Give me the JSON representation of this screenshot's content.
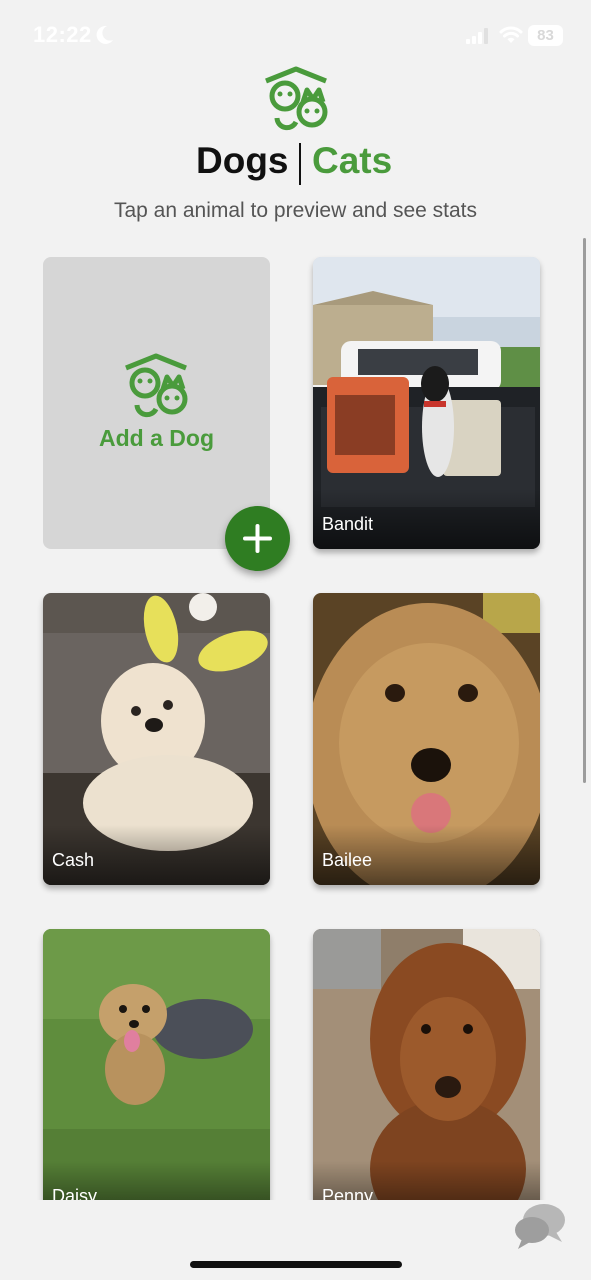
{
  "status_bar": {
    "time": "12:22",
    "battery": "83",
    "icons": [
      "moon-icon",
      "cellular-signal-icon",
      "wifi-icon",
      "battery-icon"
    ]
  },
  "header": {
    "logo_icon": "dog-cat-house-logo-icon",
    "tab_dogs": "Dogs",
    "tab_cats": "Cats",
    "subtitle": "Tap an animal to preview and see stats"
  },
  "add_card": {
    "label": "Add a Dog",
    "button_icon": "plus-icon"
  },
  "animals": [
    {
      "name": "Bandit"
    },
    {
      "name": "Cash"
    },
    {
      "name": "Bailee"
    },
    {
      "name": "Daisy"
    },
    {
      "name": "Penny"
    }
  ],
  "chat_icon": "chat-bubbles-icon",
  "colors": {
    "accent_green": "#4a9b3c",
    "fab_green": "#2f7d22",
    "background": "#f2f2f2",
    "add_card_bg": "#d6d6d6"
  }
}
